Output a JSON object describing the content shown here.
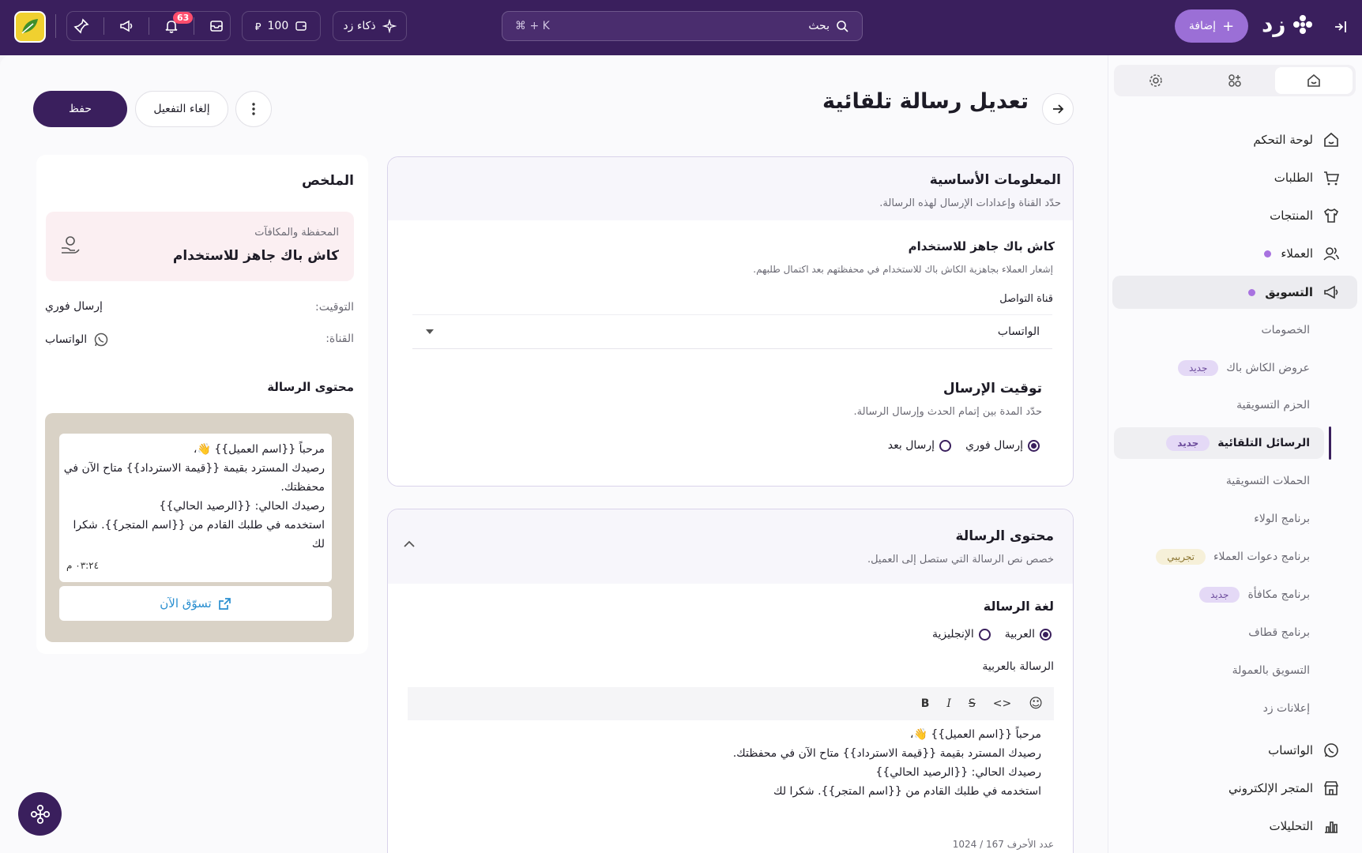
{
  "topbar": {
    "notif_count": "63",
    "balance": "100",
    "ai_label": "ذكاء زد",
    "search_placeholder": "بحث",
    "search_shortcut": "⌘ + K",
    "add_label": "إضافة",
    "brand": "زد"
  },
  "sidebar": {
    "items": [
      {
        "label": "لوحة التحكم",
        "icon": "home-icon"
      },
      {
        "label": "الطلبات",
        "icon": "cart-icon"
      },
      {
        "label": "المنتجات",
        "icon": "shirt-icon"
      },
      {
        "label": "العملاء",
        "icon": "user-icon"
      },
      {
        "label": "التسويق",
        "icon": "megaphone-icon"
      }
    ],
    "marketing_sub": [
      {
        "label": "الخصومات"
      },
      {
        "label": "عروض الكاش باك",
        "badge": "جديد"
      },
      {
        "label": "الحزم التسويقية"
      },
      {
        "label": "الرسائل التلقائية",
        "badge": "جديد"
      },
      {
        "label": "الحملات التسويقية"
      },
      {
        "label": "برنامج الولاء"
      },
      {
        "label": "برنامج دعوات العملاء",
        "badge": "تجريبي"
      },
      {
        "label": "برنامج مكافأة",
        "badge": "جديد"
      },
      {
        "label": "برنامج قطاف"
      },
      {
        "label": "التسويق بالعمولة"
      },
      {
        "label": "إعلانات زد"
      }
    ],
    "bottom_items": [
      {
        "label": "الواتساب",
        "icon": "whatsapp-icon"
      },
      {
        "label": "المتجر الإلكتروني",
        "icon": "store-icon"
      },
      {
        "label": "التحليلات",
        "icon": "chart-icon"
      }
    ]
  },
  "header": {
    "title": "تعديل رسالة تلقائية",
    "save": "حفظ",
    "deactivate": "إلغاء التفعيل"
  },
  "basic_info": {
    "title": "المعلومات الأساسية",
    "subtitle": "حدّد القناة وإعدادات الإرسال لهذه الرسالة.",
    "event_title": "كاش باك جاهز للاستخدام",
    "event_desc": "إشعار العملاء بجاهزية الكاش باك للاستخدام في محفظتهم بعد اكتمال طلبهم.",
    "channel_label": "قناة التواصل",
    "channel_value": "الواتساب",
    "timing_title": "توقيت الإرسال",
    "timing_desc": "حدّد المدة بين إتمام الحدث وإرسال الرسالة.",
    "timing_options": [
      "إرسال فوري",
      "إرسال بعد"
    ]
  },
  "content": {
    "title": "محتوى الرسالة",
    "subtitle": "خصص نص الرسالة التي ستصل إلى العميل.",
    "language_label": "لغة الرسالة",
    "language_options": [
      "العربية",
      "الإنجليزية"
    ],
    "arabic_label": "الرسالة بالعربية",
    "toolbar": [
      "B",
      "I",
      "S",
      "<>",
      "☺"
    ],
    "lines": [
      "مرحباً {{اسم العميل}} 👋،",
      "رصيدك المسترد بقيمة {{قيمة الاسترداد}} متاح الآن في محفظتك.",
      "رصيدك الحالي: {{الرصيد الحالي}}",
      "استخدمه في طلبك القادم من {{اسم المتجر}}. شكرا لك"
    ],
    "char_count": "عدد الأحرف 167 / 1024"
  },
  "summary": {
    "title": "الملخص",
    "reward_category": "المحفظة والمكافآت",
    "reward_title": "كاش باك جاهز للاستخدام",
    "timing_label": "التوقيت:",
    "timing_value": "إرسال فوري",
    "channel_label": "القناة:",
    "channel_value": "الواتساب",
    "content_label": "محتوى الرسالة",
    "preview_lines": [
      "مرحباً {{اسم العميل}} 👋،",
      "رصيدك المسترد بقيمة {{قيمة الاسترداد}} متاح الآن في",
      "محفظتك.",
      "رصيدك الحالي: {{الرصيد الحالي}}",
      "استخدمه في طلبك القادم من {{اسم المتجر}}. شكرا",
      "لك"
    ],
    "preview_time": "٠٣:٢٤ م",
    "cta": "تسوّق الآن"
  },
  "colors": {
    "primary": "#3a1f5d",
    "accent": "#9b6fd6",
    "link": "#2a8fd0"
  }
}
